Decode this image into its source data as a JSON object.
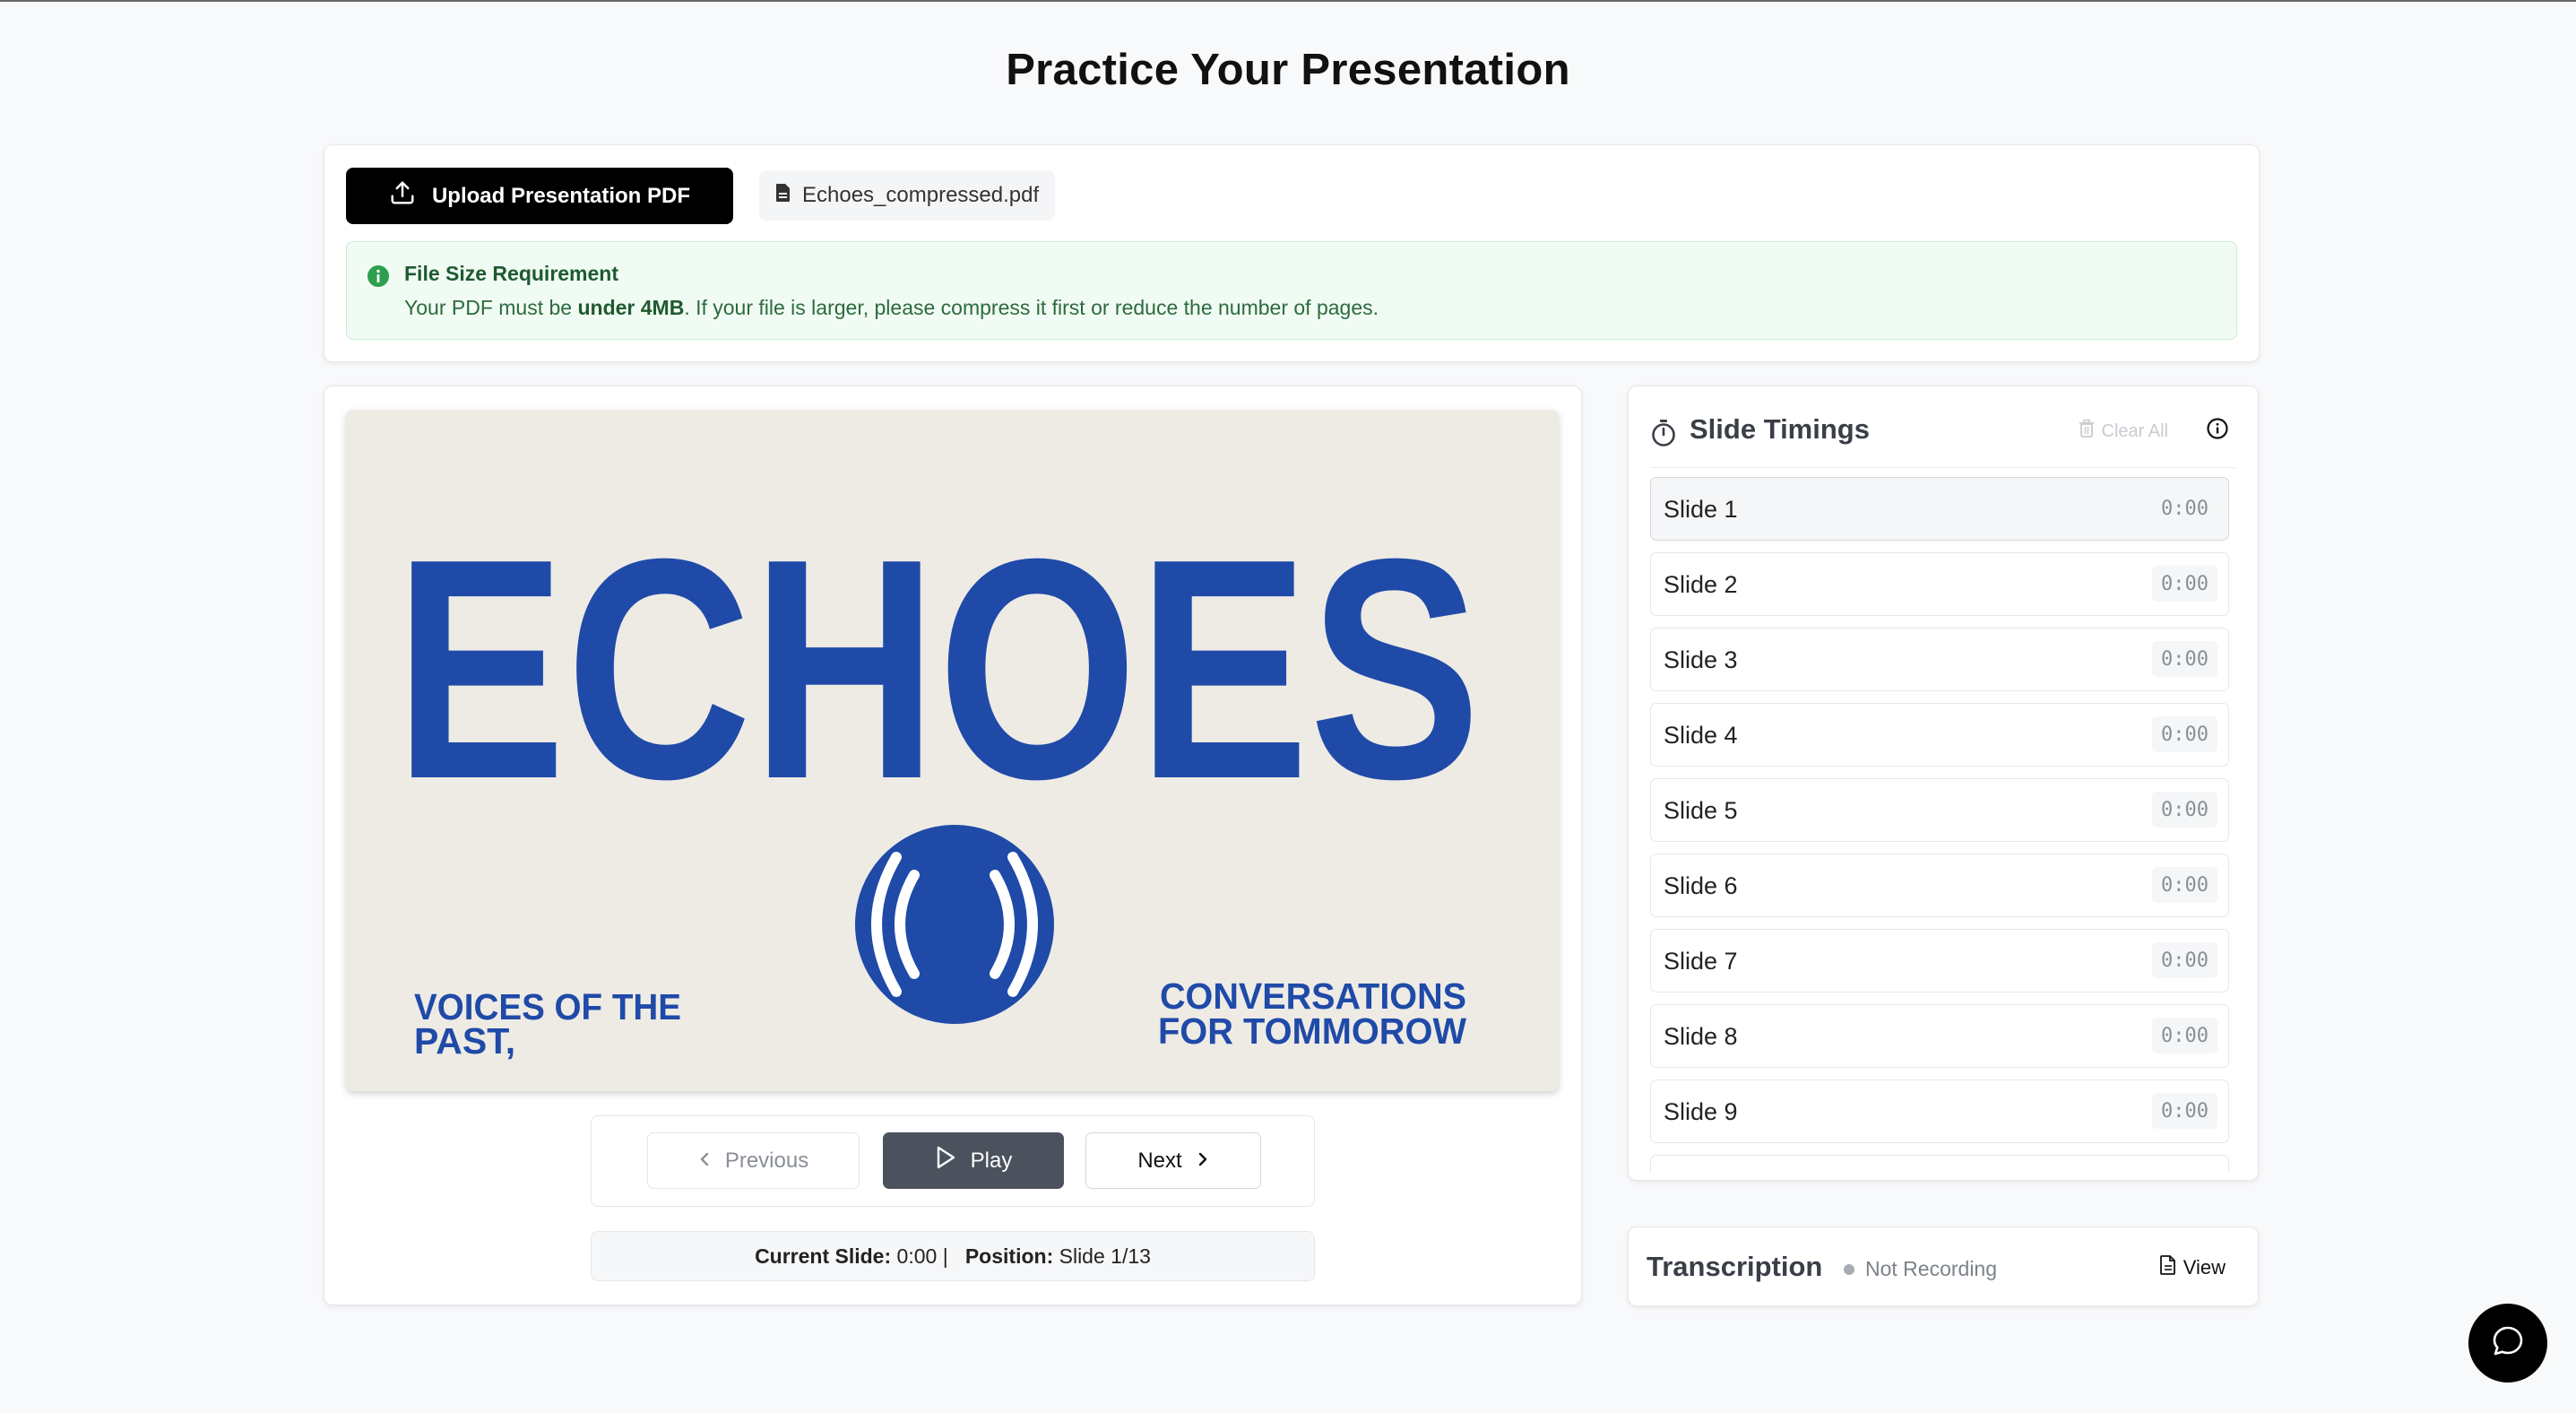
{
  "page": {
    "title": "Practice Your Presentation"
  },
  "upload": {
    "button_label": "Upload Presentation PDF",
    "file_name": "Echoes_compressed.pdf",
    "info_title": "File Size Requirement",
    "info_prefix": "Your PDF must be ",
    "info_bold": "under 4MB",
    "info_suffix": ". If your file is larger, please compress it first or reduce the number of pages."
  },
  "slide": {
    "headline": "ECHOES",
    "left_text_line1": "VOICES OF THE",
    "left_text_line2": "PAST,",
    "right_text_line1": "CONVERSATIONS",
    "right_text_line2": "FOR TOMMOROW",
    "colors": {
      "brand_blue": "#1f4aa8",
      "background": "#eeebe5"
    }
  },
  "controls": {
    "previous_label": "Previous",
    "play_label": "Play",
    "next_label": "Next"
  },
  "status": {
    "current_label": "Current Slide:",
    "current_value": "0:00",
    "separator": "|",
    "position_label": "Position:",
    "position_value": "Slide 1/13"
  },
  "timings": {
    "title": "Slide Timings",
    "clear_label": "Clear All",
    "slides": [
      {
        "label": "Slide 1",
        "time": "0:00"
      },
      {
        "label": "Slide 2",
        "time": "0:00"
      },
      {
        "label": "Slide 3",
        "time": "0:00"
      },
      {
        "label": "Slide 4",
        "time": "0:00"
      },
      {
        "label": "Slide 5",
        "time": "0:00"
      },
      {
        "label": "Slide 6",
        "time": "0:00"
      },
      {
        "label": "Slide 7",
        "time": "0:00"
      },
      {
        "label": "Slide 8",
        "time": "0:00"
      },
      {
        "label": "Slide 9",
        "time": "0:00"
      }
    ]
  },
  "transcription": {
    "title": "Transcription",
    "status": "Not Recording",
    "view_label": "View"
  },
  "icons": {
    "upload": "upload-icon",
    "file": "file-icon",
    "info": "info-icon",
    "timer": "stopwatch-icon",
    "trash": "trash-icon",
    "chevron_left": "chevron-left-icon",
    "chevron_right": "chevron-right-icon",
    "play": "play-icon",
    "chat": "chat-bubble-icon"
  }
}
